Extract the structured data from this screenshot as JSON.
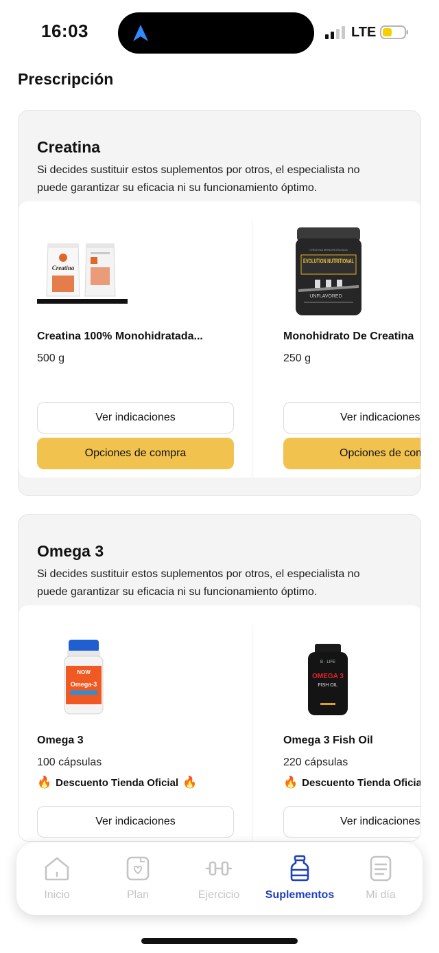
{
  "status_bar": {
    "time": "16:03",
    "network": "LTE"
  },
  "page": {
    "title": "Prescripción"
  },
  "sections": [
    {
      "title": "Creatina",
      "note": "Si decides sustituir estos suplementos por otros, el especialista no puede garantizar su eficacia ni su funcionamiento óptimo.",
      "products": [
        {
          "name": "Creatina 100% Monohidratada...",
          "size": "500 g",
          "image_label": "Creatina",
          "primary_button": "Ver indicaciones",
          "secondary_button": "Opciones de compra"
        },
        {
          "name": "Monohidrato De Creatina",
          "size": "250 g",
          "image_label": "EVOLUTION NUTRITIONAL",
          "image_sublabel": "UNFLAVORED",
          "primary_button": "Ver indicaciones",
          "secondary_button": "Opciones de compra"
        }
      ]
    },
    {
      "title": "Omega 3",
      "note": "Si decides sustituir estos suplementos por otros, el especialista no puede garantizar su eficacia ni su funcionamiento óptimo.",
      "products": [
        {
          "name": "Omega 3",
          "size": "100 cápsulas",
          "promo": "Descuento Tienda Oficial",
          "image_label": "Omega-3",
          "image_brand": "NOW",
          "primary_button": "Ver indicaciones"
        },
        {
          "name": "Omega 3 Fish Oil",
          "size": "220 cápsulas",
          "promo": "Descuento Tienda Oficial",
          "image_label": "OMEGA 3",
          "image_sublabel": "FISH OIL",
          "primary_button": "Ver indicaciones"
        }
      ]
    }
  ],
  "nav": {
    "items": [
      {
        "label": "Inicio",
        "icon": "home-icon"
      },
      {
        "label": "Plan",
        "icon": "plan-icon"
      },
      {
        "label": "Ejercicio",
        "icon": "dumbbell-icon"
      },
      {
        "label": "Suplementos",
        "icon": "bottle-icon"
      },
      {
        "label": "Mi día",
        "icon": "document-icon"
      }
    ],
    "active": "Suplementos"
  },
  "colors": {
    "accent": "#f2c24e",
    "nav_active": "#1f3fbf",
    "nav_inactive": "#c4c4c4"
  }
}
